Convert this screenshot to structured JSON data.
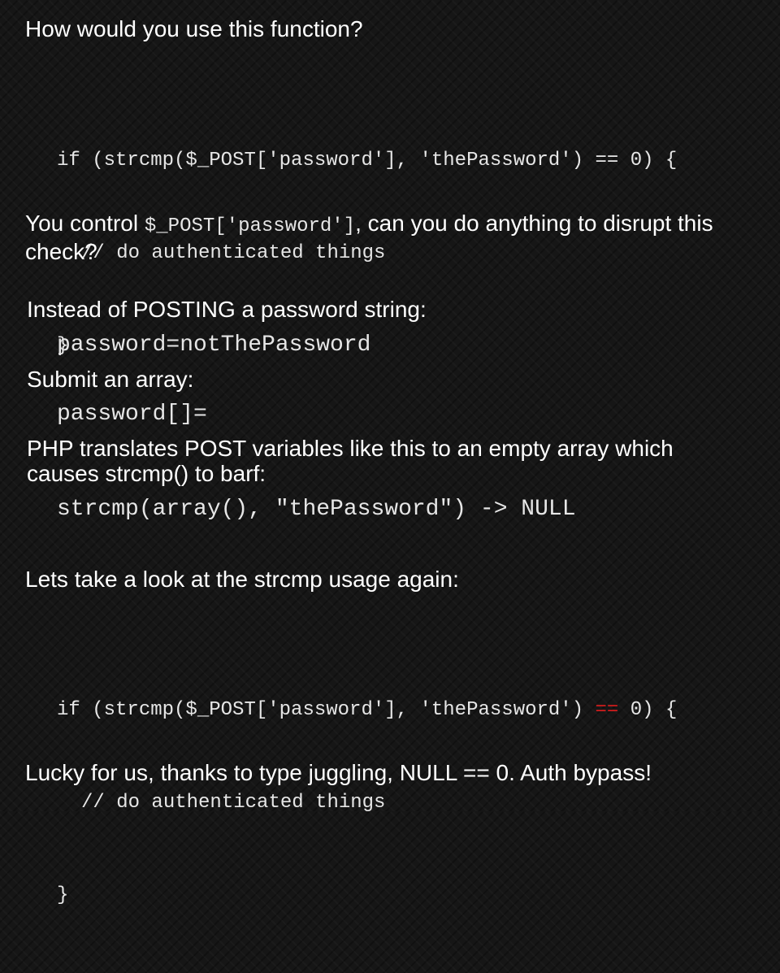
{
  "question": "How would you use this function?",
  "code_block_1": {
    "line1": "if (strcmp($_POST['password'], 'thePassword') == 0) {",
    "line2": "// do authenticated things",
    "line3": "}"
  },
  "control": {
    "prefix": "You control ",
    "code": "$_POST['password']",
    "suffix": ", can you do anything to disrupt this check?"
  },
  "answer": {
    "instead_label": "Instead of POSTING a password string:",
    "instead_code": "password=notThePassword",
    "submit_label": "Submit an array:",
    "submit_code": "password[]=",
    "php_label": "PHP translates POST variables like this to an empty array which causes strcmp() to barf:",
    "php_code": "strcmp(array(), \"thePassword\") -> NULL"
  },
  "lookagain": "Lets take a look at the strcmp usage again:",
  "code_block_2": {
    "line1_pre": "if (strcmp($_POST['password'], 'thePassword') ",
    "line1_highlight": "==",
    "line1_post": " 0) {",
    "line2": "// do authenticated things",
    "line3": "}"
  },
  "conclusion": "Lucky for us, thanks to type juggling, NULL == 0. Auth bypass!",
  "colors": {
    "background": "#161616",
    "text": "#ffffff",
    "code": "#e6e6e6",
    "highlight": "#d11c1c"
  }
}
